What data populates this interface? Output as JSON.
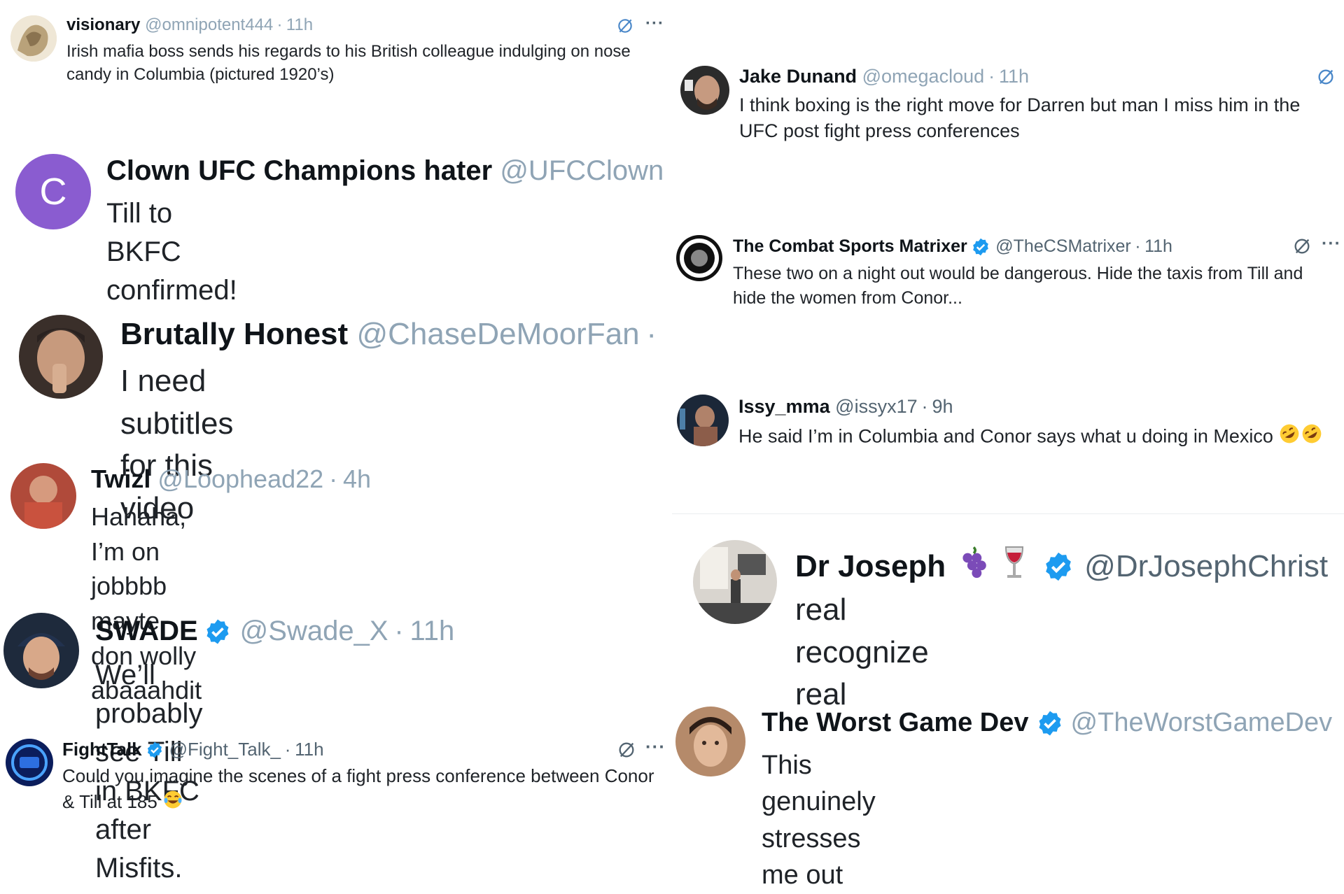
{
  "tweets": [
    {
      "id": "t1",
      "name": "visionary",
      "handle": "@omnipotent444",
      "time": "11h",
      "text": "Irish mafia boss sends his regards to his British colleague indulging on nose candy in Columbia (pictured 1920’s)"
    },
    {
      "id": "t2",
      "name": "Clown UFC Champions hater",
      "handle": "@UFCClown",
      "avatar_letter": "C",
      "text": "Till to BKFC confirmed!"
    },
    {
      "id": "t3",
      "name": "Brutally Honest",
      "handle": "@ChaseDeMoorFan",
      "dot": "·",
      "text": "I need subtitles for this video"
    },
    {
      "id": "t4",
      "name": "Twizl",
      "handle": "@Loophead22",
      "time": "4h",
      "text": "Hahaha, I’m on jobbbb mayte don wolly abaaahdit"
    },
    {
      "id": "t5",
      "name": "SWADE",
      "handle": "@Swade_X",
      "time": "11h",
      "text": "We’ll probably see Till in BKFC after Misfits."
    },
    {
      "id": "t6",
      "name": "FightTalk",
      "handle": "@Fight_Talk_",
      "time": "11h",
      "text": "Could you imagine the scenes of a fight press conference between Conor & Till at 185",
      "more": "···"
    },
    {
      "id": "t7",
      "name": "Jake Dunand",
      "handle": "@omegacloud",
      "time": "11h",
      "text": "I think boxing is the right move for Darren but man I miss him in the UFC post fight press conferences"
    },
    {
      "id": "t8",
      "name": "The Combat Sports Matrixer",
      "handle": "@TheCSMatrixer",
      "time": "11h",
      "text": "These two on a night out would be dangerous. Hide the taxis from Till and hide the women from Conor...",
      "more": "···"
    },
    {
      "id": "t9",
      "name": "Issy_mma",
      "handle": "@issyx17",
      "time": "9h",
      "text": "He said I’m in Columbia and Conor says what u doing in Mexico"
    },
    {
      "id": "t10",
      "name": "Dr Joseph",
      "handle": "@DrJosephChrist",
      "text": "real recognize real"
    },
    {
      "id": "t11",
      "name": "The Worst Game Dev",
      "handle": "@TheWorstGameDev",
      "text": "This genuinely stresses me out"
    }
  ],
  "first_more": "···",
  "sep": "·",
  "colors": {
    "verified": "#1d9bf0",
    "handle": "#8fa4b5",
    "clown_avatar": "#8a5cd0",
    "action": "#4b88c9"
  },
  "icons": [
    "grok-icon",
    "more-icon",
    "verified-badge-icon"
  ]
}
